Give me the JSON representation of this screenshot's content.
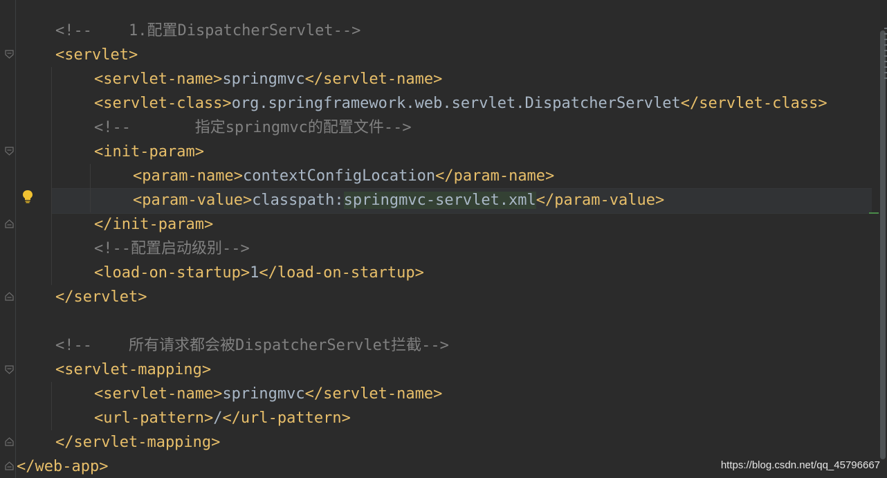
{
  "editor": {
    "lines": [
      {
        "parts": [
          {
            "t": "<!--    1.配置DispatcherServlet-->",
            "k": "cm"
          }
        ]
      },
      {
        "parts": [
          {
            "t": "<servlet>",
            "k": "tag"
          }
        ]
      },
      {
        "parts": [
          {
            "t": "<servlet-name>",
            "k": "tag"
          },
          {
            "t": "springmvc",
            "k": "txt"
          },
          {
            "t": "</servlet-name>",
            "k": "tag"
          }
        ]
      },
      {
        "parts": [
          {
            "t": "<servlet-class>",
            "k": "tag"
          },
          {
            "t": "org.springframework.web.servlet.DispatcherServlet",
            "k": "txt"
          },
          {
            "t": "</servlet-class>",
            "k": "tag"
          }
        ]
      },
      {
        "parts": [
          {
            "t": "<!--       指定springmvc的配置文件-->",
            "k": "cm"
          }
        ]
      },
      {
        "parts": [
          {
            "t": "<init-param>",
            "k": "tag"
          }
        ]
      },
      {
        "parts": [
          {
            "t": "<param-name>",
            "k": "tag"
          },
          {
            "t": "contextConfigLocation",
            "k": "txt"
          },
          {
            "t": "</param-name>",
            "k": "tag"
          }
        ]
      },
      {
        "parts": [
          {
            "t": "<param-value>",
            "k": "tag"
          },
          {
            "t": "classpath:",
            "k": "txt"
          },
          {
            "t": "springmvc-servlet.xml",
            "k": "hl"
          },
          {
            "t": "</param-value>",
            "k": "tag"
          }
        ]
      },
      {
        "parts": [
          {
            "t": "</init-param>",
            "k": "tag"
          }
        ]
      },
      {
        "parts": [
          {
            "t": "<!--配置启动级别-->",
            "k": "cm"
          }
        ]
      },
      {
        "parts": [
          {
            "t": "<load-on-startup>",
            "k": "tag"
          },
          {
            "t": "1",
            "k": "txt"
          },
          {
            "t": "</load-on-startup>",
            "k": "tag"
          }
        ]
      },
      {
        "parts": [
          {
            "t": "</servlet>",
            "k": "tag"
          }
        ]
      },
      {
        "parts": []
      },
      {
        "parts": [
          {
            "t": "<!--    所有请求都会被DispatcherServlet拦截-->",
            "k": "cm"
          }
        ]
      },
      {
        "parts": [
          {
            "t": "<servlet-mapping>",
            "k": "tag"
          }
        ]
      },
      {
        "parts": [
          {
            "t": "<servlet-name>",
            "k": "tag"
          },
          {
            "t": "springmvc",
            "k": "txt"
          },
          {
            "t": "</servlet-name>",
            "k": "tag"
          }
        ]
      },
      {
        "parts": [
          {
            "t": "<url-pattern>",
            "k": "tag"
          },
          {
            "t": "/",
            "k": "txt"
          },
          {
            "t": "</url-pattern>",
            "k": "tag"
          }
        ]
      },
      {
        "parts": [
          {
            "t": "</servlet-mapping>",
            "k": "tag"
          }
        ]
      },
      {
        "parts": [
          {
            "t": "</web-app>",
            "k": "tag"
          }
        ]
      }
    ]
  },
  "watermark": "https://blog.csdn.net/qq_45796667",
  "colors": {
    "background": "#2b2b2b",
    "tag": "#e8bf6a",
    "text": "#a9b7c6",
    "comment": "#808080",
    "highlight": "#344134"
  }
}
